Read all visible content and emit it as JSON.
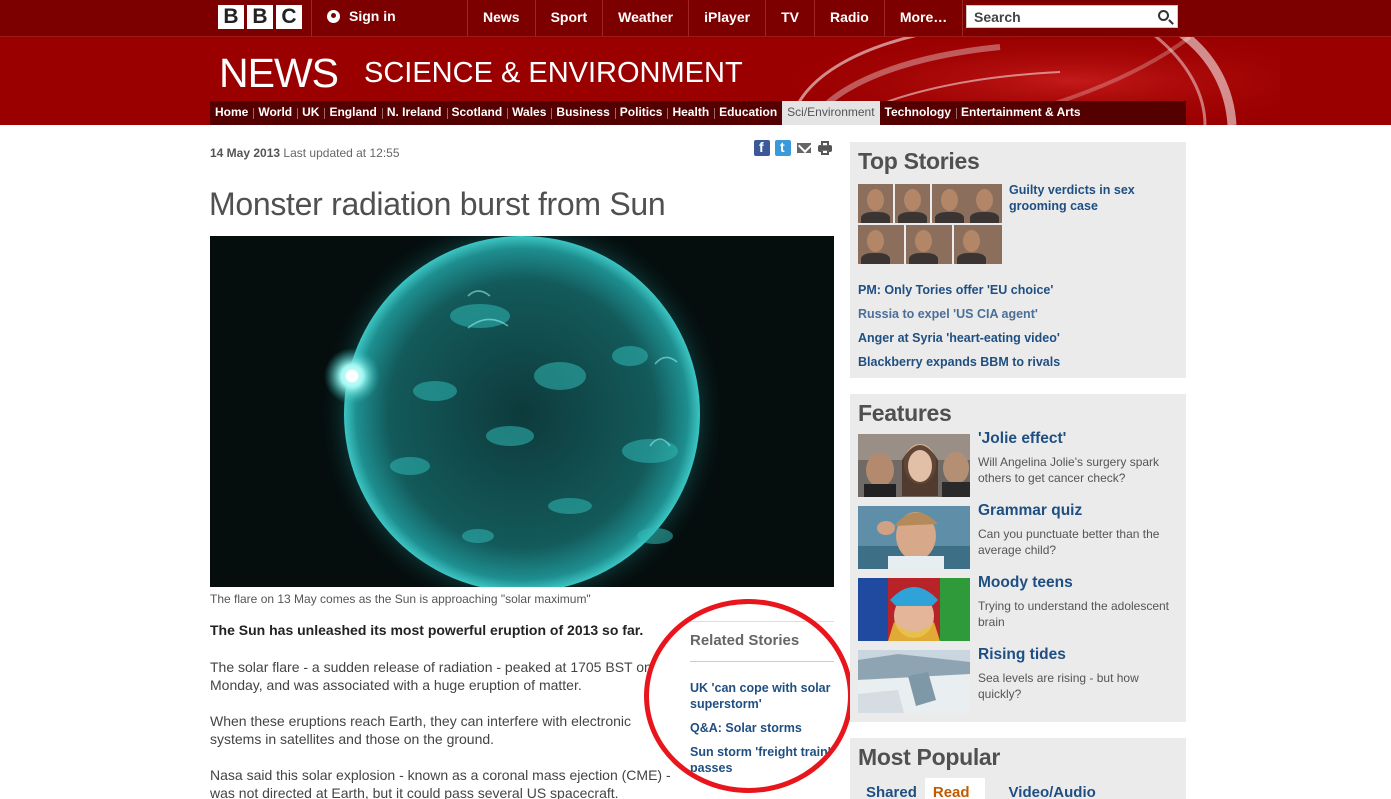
{
  "masthead": {
    "logo_letters": [
      "B",
      "B",
      "C"
    ],
    "signin_label": "Sign in",
    "nav": [
      "News",
      "Sport",
      "Weather",
      "iPlayer",
      "TV",
      "Radio",
      "More…"
    ],
    "search_placeholder": "Search"
  },
  "banner": {
    "news_logo": "NEWS",
    "section_title": "SCIENCE & ENVIRONMENT"
  },
  "section_nav": {
    "items": [
      "Home",
      "World",
      "UK",
      "England",
      "N. Ireland",
      "Scotland",
      "Wales",
      "Business",
      "Politics",
      "Health",
      "Education",
      "Sci/Environment",
      "Technology",
      "Entertainment & Arts"
    ],
    "active": "Sci/Environment"
  },
  "article": {
    "date": "14 May 2013",
    "updated": "Last updated at 12:55",
    "headline": "Monster radiation burst from Sun",
    "caption": "The flare on 13 May comes as the Sun is approaching \"solar maximum\"",
    "intro": "The Sun has unleashed its most powerful eruption of 2013 so far.",
    "paragraphs": [
      "The solar flare - a sudden release of radiation - peaked at 1705 BST on Monday, and was associated with a huge eruption of matter.",
      "When these eruptions reach Earth, they can interfere with electronic systems in satellites and those on the ground.",
      "Nasa said this solar explosion - known as a coronal mass ejection (CME) - was not directed at Earth, but it could pass several US spacecraft."
    ],
    "share_icons": [
      "facebook-icon",
      "twitter-icon",
      "email-icon",
      "print-icon"
    ]
  },
  "related": {
    "heading": "Related Stories",
    "links": [
      "UK 'can cope with solar superstorm'",
      "Q&A: Solar storms",
      "Sun storm 'freight train' passes"
    ]
  },
  "top_stories": {
    "heading": "Top Stories",
    "lead": "Guilty verdicts in sex grooming case",
    "items": [
      "PM: Only Tories offer 'EU choice'",
      "Russia to expel 'US CIA agent'",
      "Anger at Syria 'heart-eating video'",
      "Blackberry expands BBM to rivals"
    ]
  },
  "features": {
    "heading": "Features",
    "items": [
      {
        "title": "'Jolie effect'",
        "desc": "Will Angelina Jolie's surgery spark others to get cancer check?"
      },
      {
        "title": "Grammar quiz",
        "desc": "Can you punctuate better than the average child?"
      },
      {
        "title": "Moody teens",
        "desc": "Trying to understand the adolescent brain"
      },
      {
        "title": "Rising tides",
        "desc": "Sea levels are rising - but how quickly?"
      }
    ]
  },
  "most_popular": {
    "heading": "Most Popular",
    "tabs": [
      "Shared",
      "Read",
      "Video/Audio"
    ],
    "active_tab": "Read"
  },
  "colors": {
    "bar_red": "#7d0000",
    "banner_red": "#9b0000",
    "link_blue": "#1f4f82",
    "annotation_red": "#e8161c"
  }
}
